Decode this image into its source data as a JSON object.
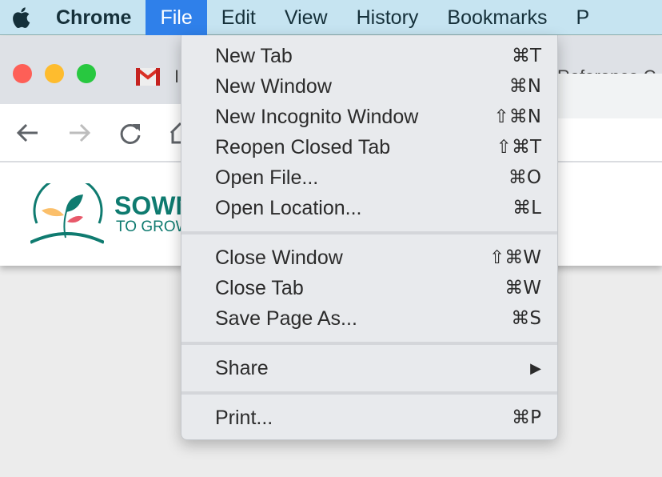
{
  "menubar": {
    "app": "Chrome",
    "items": [
      "File",
      "Edit",
      "View",
      "History",
      "Bookmarks",
      "P"
    ],
    "active": "File"
  },
  "tabs": [
    {
      "title": "I",
      "icon": "gmail-icon"
    },
    {
      "title": "Reference C"
    }
  ],
  "page": {
    "logo_title": "SOWN",
    "logo_subtitle": "TO GROW"
  },
  "file_menu": {
    "groups": [
      [
        {
          "label": "New Tab",
          "shortcut": "⌘T"
        },
        {
          "label": "New Window",
          "shortcut": "⌘N"
        },
        {
          "label": "New Incognito Window",
          "shortcut": "⇧⌘N"
        },
        {
          "label": "Reopen Closed Tab",
          "shortcut": "⇧⌘T"
        },
        {
          "label": "Open File...",
          "shortcut": "⌘O"
        },
        {
          "label": "Open Location...",
          "shortcut": "⌘L"
        }
      ],
      [
        {
          "label": "Close Window",
          "shortcut": "⇧⌘W"
        },
        {
          "label": "Close Tab",
          "shortcut": "⌘W"
        },
        {
          "label": "Save Page As...",
          "shortcut": "⌘S"
        }
      ],
      [
        {
          "label": "Share",
          "shortcut": "▶"
        }
      ],
      [
        {
          "label": "Print...",
          "shortcut": "⌘P"
        }
      ]
    ]
  },
  "colors": {
    "menubar": "#c6e4f1",
    "active": "#2f80ea",
    "brand": "#0f7b70"
  }
}
